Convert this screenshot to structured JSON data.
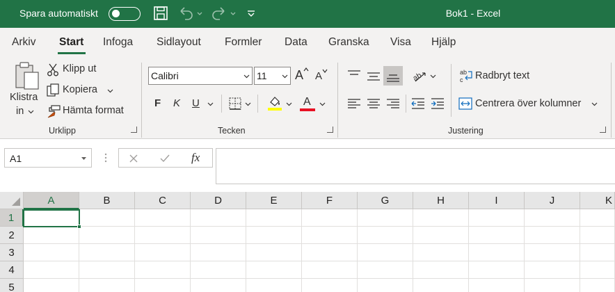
{
  "titlebar": {
    "autosave_label": "Spara automatiskt",
    "doc_title": "Bok1  -  Excel",
    "bg_color": "#217346"
  },
  "tabs": [
    "Arkiv",
    "Start",
    "Infoga",
    "Sidlayout",
    "Formler",
    "Data",
    "Granska",
    "Visa",
    "Hjälp"
  ],
  "active_tab": "Start",
  "clipboard": {
    "paste_line1": "Klistra",
    "paste_line2": "in",
    "cut": "Klipp ut",
    "copy": "Kopiera",
    "format_painter": "Hämta format",
    "group_label": "Urklipp"
  },
  "font": {
    "font_name": "Calibri",
    "font_size": "11",
    "grow_label": "A",
    "shrink_label": "A",
    "bold_label": "F",
    "italic_label": "K",
    "underline_label": "U",
    "font_color_label": "A",
    "group_label": "Tecken",
    "highlight_color": "#ffff00",
    "font_color": "#e81123"
  },
  "alignment": {
    "wrap_text": "Radbryt text",
    "merge_center": "Centrera över kolumner",
    "group_label": "Justering"
  },
  "formula_bar": {
    "name_box": "A1",
    "fx_label": "fx",
    "value": ""
  },
  "grid": {
    "columns": [
      "A",
      "B",
      "C",
      "D",
      "E",
      "F",
      "G",
      "H",
      "I",
      "J",
      "K"
    ],
    "rows": [
      "1",
      "2",
      "3",
      "4",
      "5"
    ],
    "selected_column": "A",
    "selected_row": "1",
    "accent_color": "#217346"
  }
}
